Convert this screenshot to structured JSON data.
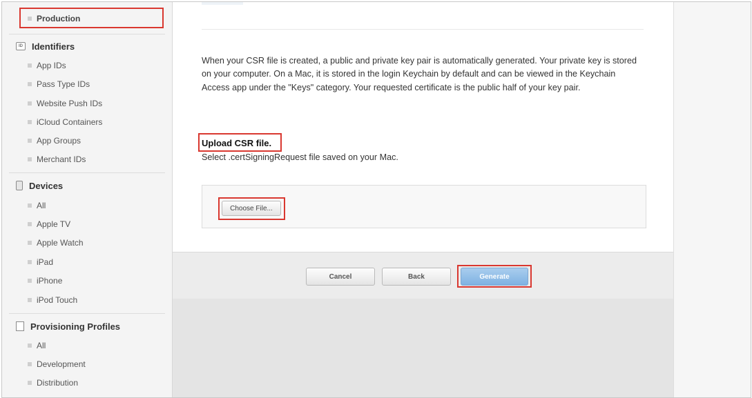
{
  "sidebar": {
    "top_item": "Production",
    "identifiers": {
      "heading": "Identifiers",
      "icon": "id-card-icon",
      "items": [
        "App IDs",
        "Pass Type IDs",
        "Website Push IDs",
        "iCloud Containers",
        "App Groups",
        "Merchant IDs"
      ]
    },
    "devices": {
      "heading": "Devices",
      "icon": "device-icon",
      "items": [
        "All",
        "Apple TV",
        "Apple Watch",
        "iPad",
        "iPhone",
        "iPod Touch"
      ]
    },
    "profiles": {
      "heading": "Provisioning Profiles",
      "icon": "document-icon",
      "items": [
        "All",
        "Development",
        "Distribution"
      ]
    }
  },
  "main": {
    "description": "When your CSR file is created, a public and private key pair is automatically generated. Your private key is stored on your computer. On a Mac, it is stored in the login Keychain by default and can be viewed in the Keychain Access app under the \"Keys\" category. Your requested certificate is the public half of your key pair.",
    "upload_title": "Upload CSR file.",
    "upload_subtitle": "Select .certSigningRequest file saved on your Mac.",
    "choose_file_label": "Choose File...",
    "cancel_label": "Cancel",
    "back_label": "Back",
    "generate_label": "Generate"
  },
  "colors": {
    "highlight": "#d9372f",
    "generate_button": "#8fbde8",
    "sidebar_bg": "#f4f4f4"
  }
}
